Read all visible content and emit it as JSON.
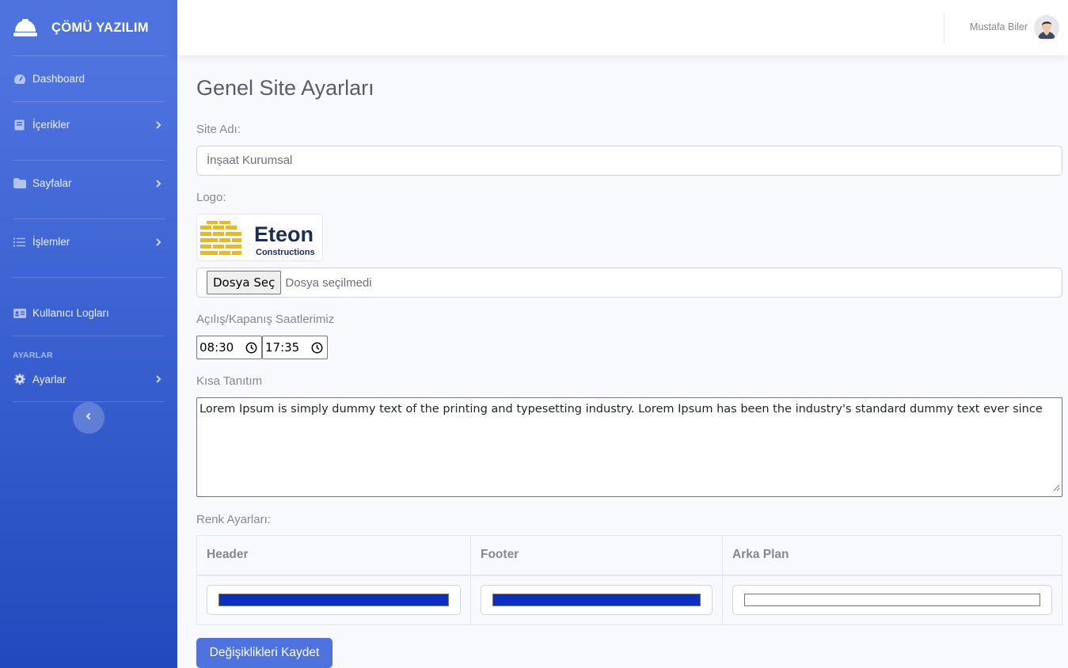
{
  "brand": {
    "name": "ÇÖMÜ YAZILIM",
    "icon": "hard-hat-icon"
  },
  "sidebar": {
    "items": [
      {
        "label": "Dashboard",
        "icon": "tachometer-icon",
        "has_chevron": false
      },
      {
        "label": "İçerikler",
        "icon": "book-icon",
        "has_chevron": true
      },
      {
        "label": "Sayfalar",
        "icon": "folder-icon",
        "has_chevron": true
      },
      {
        "label": "İşlemler",
        "icon": "list-icon",
        "has_chevron": true
      },
      {
        "label": "Kullanıcı Logları",
        "icon": "id-card-icon",
        "has_chevron": false
      }
    ],
    "heading": "AYARLAR",
    "settings_item": {
      "label": "Ayarlar",
      "icon": "cog-icon",
      "has_chevron": true
    }
  },
  "topbar": {
    "user_name": "Mustafa Biler"
  },
  "page": {
    "title": "Genel Site Ayarları",
    "site_name_label": "Site Adı:",
    "site_name_value": "İnşaat Kurumsal",
    "logo_label": "Logo:",
    "logo": {
      "name": "Eteon",
      "tagline": "Constructions",
      "accent": "#f5b70a",
      "text_color": "#1b2e52"
    },
    "file_button": "Dosya Seç",
    "file_status": "Dosya seçilmedi",
    "hours_label": "Açılış/Kapanış Saatlerimiz",
    "open_time": "08:30",
    "close_time": "17:35",
    "intro_label": "Kısa Tanıtım",
    "intro_text": "Lorem Ipsum is simply dummy text of the printing and typesetting industry. Lorem Ipsum has been the industry's standard dummy text ever since",
    "color_label": "Renk Ayarları:",
    "color_columns": [
      "Header",
      "Footer",
      "Arka Plan"
    ],
    "colors": {
      "header": "#0d2ec2",
      "footer": "#0d2ec2",
      "background": "#ffffff"
    },
    "save_button": "Değişiklikleri Kaydet"
  },
  "theme": {
    "primary": "#4e73df",
    "sidebar_end": "#224abe"
  }
}
